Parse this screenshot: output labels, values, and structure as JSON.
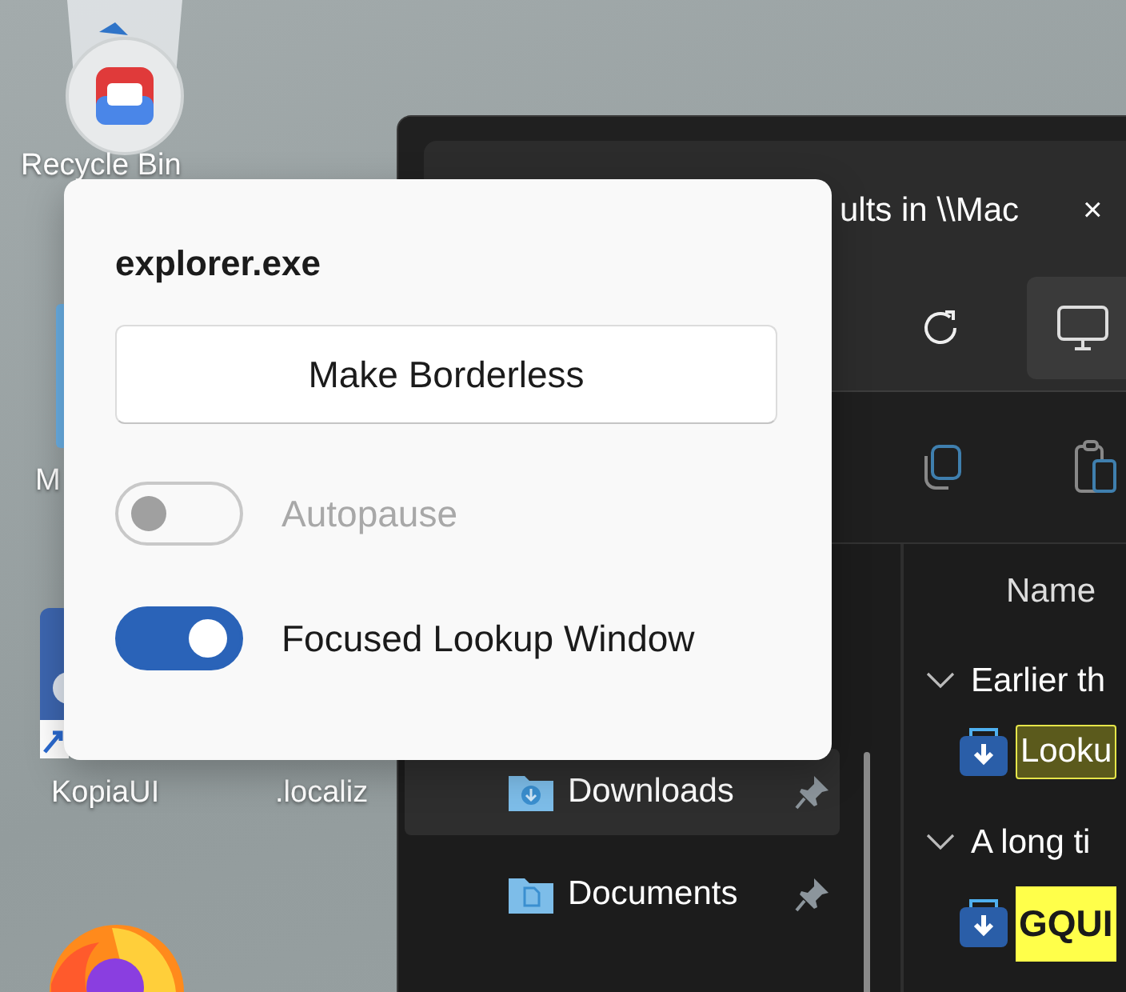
{
  "desktop_icons": [
    {
      "kind": "bin",
      "label": "Recycle Bin"
    },
    {
      "kind": "folder",
      "label": "M"
    },
    {
      "kind": "app",
      "label": "KopiaUI"
    },
    {
      "kind": "file",
      "label": ".localiz"
    },
    {
      "kind": "browser"
    }
  ],
  "explorer": {
    "tab_title": "ults in \\\\Mac",
    "close": "×",
    "nav_items": [
      {
        "kind": "downloads",
        "label": "Downloads",
        "selected": true,
        "pinned": true
      },
      {
        "kind": "documents",
        "label": "Documents",
        "selected": false,
        "pinned": true
      }
    ],
    "column": "Name",
    "groups": [
      {
        "label": "Earlier th",
        "expanded": true,
        "files": [
          {
            "name": "Looku",
            "kind": "dim"
          }
        ]
      },
      {
        "label": "A long ti",
        "expanded": true,
        "files": [
          {
            "name": "GQUI",
            "kind": "bright"
          }
        ]
      }
    ]
  },
  "popup": {
    "title": "explorer.exe",
    "button": "Make Borderless",
    "toggles": [
      {
        "label": "Autopause",
        "on": false,
        "disabled": true
      },
      {
        "label": "Focused Lookup Window",
        "on": true,
        "disabled": false
      }
    ]
  }
}
